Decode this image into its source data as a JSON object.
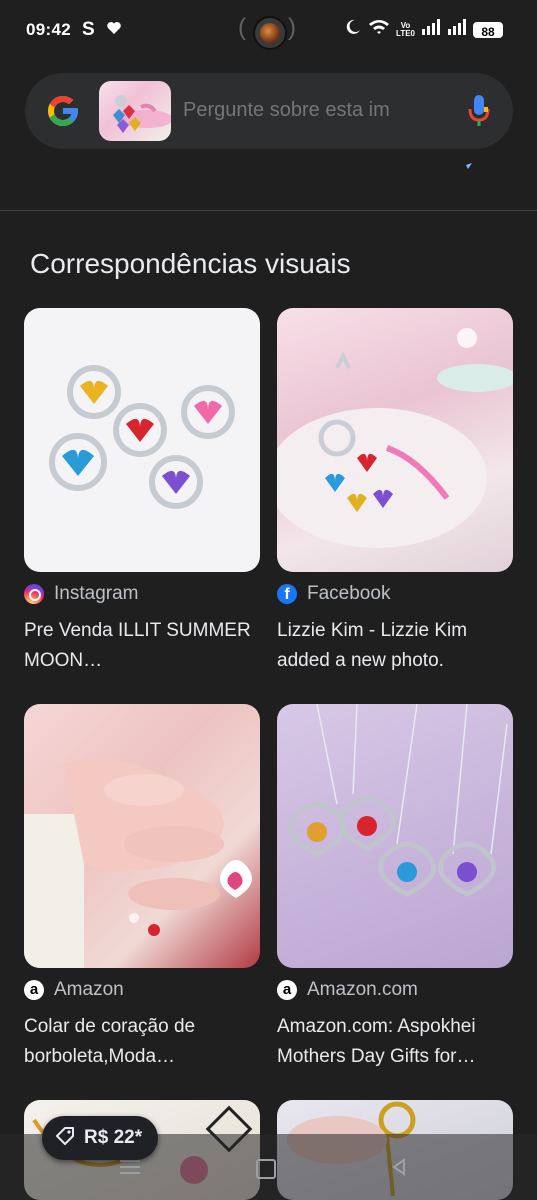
{
  "status_bar": {
    "time": "09:42",
    "carrier_icon": "S",
    "volte_label_top": "Vo",
    "volte_label_bottom": "LTE0",
    "battery": "88"
  },
  "search": {
    "placeholder": "Pergunte sobre esta im",
    "thumb_alt": "sample heart keychain image"
  },
  "section": {
    "title": "Correspondências visuais"
  },
  "results": [
    {
      "source": "Instagram",
      "source_icon": "instagram-icon",
      "title": "Pre Venda ILLIT SUMMER MOON…"
    },
    {
      "source": "Facebook",
      "source_icon": "facebook-icon",
      "title": "Lizzie Kim - Lizzie Kim added a new photo."
    },
    {
      "source": "Amazon",
      "source_icon": "amazon-icon",
      "title": "Colar de coração de borboleta,Moda…"
    },
    {
      "source": "Amazon.com",
      "source_icon": "amazon-icon",
      "title": "Amazon.com: Aspokhei Mothers Day Gifts for…"
    },
    {
      "source": "",
      "source_icon": "",
      "title": ""
    },
    {
      "source": "",
      "source_icon": "",
      "title": ""
    }
  ],
  "price_chip": {
    "label": "R$ 22*"
  },
  "colors": {
    "background": "#1f1f1f",
    "search_bg": "#2d2e30",
    "google_blue": "#4285f4",
    "google_red": "#ea4335",
    "google_yellow": "#fbbc05",
    "google_green": "#34a853"
  }
}
